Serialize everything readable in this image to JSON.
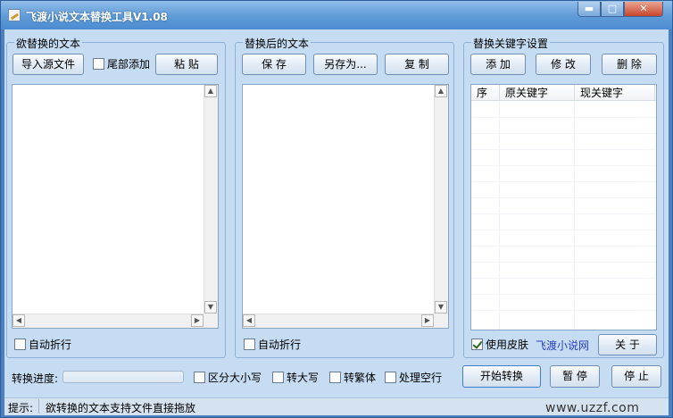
{
  "window": {
    "title": "飞渡小说文本替换工具V1.08",
    "min_glyph": "▬",
    "max_glyph": "□",
    "close_glyph": "✕"
  },
  "source": {
    "legend": "欲替换的文本",
    "import_label": "导入源文件",
    "tail_add_label": "尾部添加",
    "paste_label": "粘 贴",
    "wrap_label": "自动折行"
  },
  "result": {
    "legend": "替换后的文本",
    "save_label": "保 存",
    "save_as_label": "另存为...",
    "copy_label": "复 制",
    "wrap_label": "自动折行"
  },
  "keywords": {
    "legend": "替换关键字设置",
    "add_label": "添 加",
    "edit_label": "修 改",
    "delete_label": "删 除",
    "columns": [
      "序",
      "原关键字",
      "现关键字"
    ],
    "skin_label": "使用皮肤",
    "site_link": "飞渡小说网",
    "about_label": "关 于"
  },
  "bottom": {
    "progress_label": "转换进度:",
    "progress_value": 0,
    "case_label": "区分大小写",
    "upper_label": "转大写",
    "trad_label": "转繁体",
    "blank_label": "处理空行",
    "start_label": "开始转换",
    "pause_label": "暂 停",
    "stop_label": "停 止"
  },
  "status": {
    "prefix": "提示:",
    "message": "欲转换的文本支持文件直接拖放",
    "watermark": "www.uzzf.com"
  },
  "scroll": {
    "up": "▲",
    "down": "▼",
    "left": "◀",
    "right": "▶"
  }
}
